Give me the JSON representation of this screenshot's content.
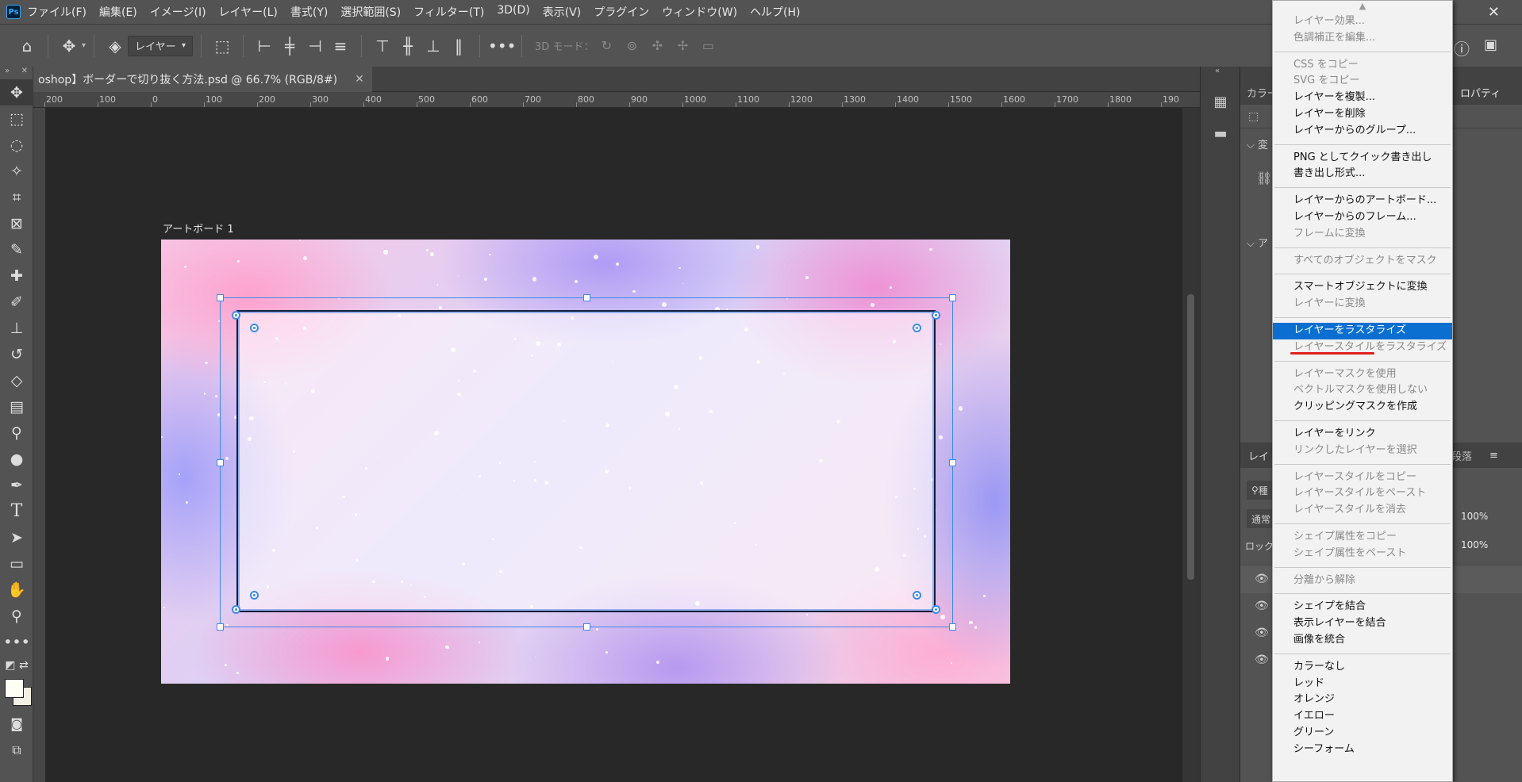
{
  "app": {
    "logo": "Ps"
  },
  "menu": [
    "ファイル(F)",
    "編集(E)",
    "イメージ(I)",
    "レイヤー(L)",
    "書式(Y)",
    "選択範囲(S)",
    "フィルター(T)",
    "3D(D)",
    "表示(V)",
    "プラグイン",
    "ウィンドウ(W)",
    "ヘルプ(H)"
  ],
  "options": {
    "layer_select": "レイヤー",
    "mode_3d": "3D モード："
  },
  "document": {
    "tab_title": "oshop】ボーダーで切り抜く方法.psd @ 66.7% (RGB/8#)",
    "artboard_label": "アートボード 1"
  },
  "ruler": [
    "200",
    "100",
    "0",
    "100",
    "200",
    "300",
    "400",
    "500",
    "600",
    "700",
    "800",
    "900",
    "1000",
    "1100",
    "1200",
    "1300",
    "1400",
    "1500",
    "1600",
    "1700",
    "1800",
    "190"
  ],
  "right_panel": {
    "tabs_top": [
      "カラー",
      "ロパティ"
    ],
    "section1": "変",
    "section2": "ア",
    "layers_tab": "レイ",
    "para_tab": "段落",
    "search": "種",
    "blend": "通常",
    "lock": "ロック",
    "opacity": "100%",
    "fill": "100%"
  },
  "context_menu": {
    "groups": [
      [
        {
          "label": "レイヤー効果...",
          "disabled": true
        },
        {
          "label": "色調補正を編集...",
          "disabled": true
        }
      ],
      [
        {
          "label": "CSS をコピー",
          "disabled": true
        },
        {
          "label": "SVG をコピー",
          "disabled": true
        },
        {
          "label": "レイヤーを複製...",
          "disabled": false
        },
        {
          "label": "レイヤーを削除",
          "disabled": false
        },
        {
          "label": "レイヤーからのグループ...",
          "disabled": false
        }
      ],
      [
        {
          "label": "PNG としてクイック書き出し",
          "disabled": false
        },
        {
          "label": "書き出し形式...",
          "disabled": false
        }
      ],
      [
        {
          "label": "レイヤーからのアートボード...",
          "disabled": false
        },
        {
          "label": "レイヤーからのフレーム...",
          "disabled": false
        },
        {
          "label": "フレームに変換",
          "disabled": true
        }
      ],
      [
        {
          "label": "すべてのオブジェクトをマスク",
          "disabled": true
        }
      ],
      [
        {
          "label": "スマートオブジェクトに変換",
          "disabled": false
        },
        {
          "label": "レイヤーに変換",
          "disabled": true
        }
      ],
      [
        {
          "label": "レイヤーをラスタライズ",
          "disabled": false,
          "highlighted": true
        },
        {
          "label": "レイヤースタイルをラスタライズ",
          "disabled": true
        }
      ],
      [
        {
          "label": "レイヤーマスクを使用",
          "disabled": true
        },
        {
          "label": "ベクトルマスクを使用しない",
          "disabled": true
        },
        {
          "label": "クリッピングマスクを作成",
          "disabled": false
        }
      ],
      [
        {
          "label": "レイヤーをリンク",
          "disabled": false
        },
        {
          "label": "リンクしたレイヤーを選択",
          "disabled": true
        }
      ],
      [
        {
          "label": "レイヤースタイルをコピー",
          "disabled": true
        },
        {
          "label": "レイヤースタイルをペースト",
          "disabled": true
        },
        {
          "label": "レイヤースタイルを消去",
          "disabled": true
        }
      ],
      [
        {
          "label": "シェイプ属性をコピー",
          "disabled": true
        },
        {
          "label": "シェイプ属性をペースト",
          "disabled": true
        }
      ],
      [
        {
          "label": "分離から解除",
          "disabled": true
        }
      ],
      [
        {
          "label": "シェイプを結合",
          "disabled": false
        },
        {
          "label": "表示レイヤーを結合",
          "disabled": false
        },
        {
          "label": "画像を統合",
          "disabled": false
        }
      ],
      [
        {
          "label": "カラーなし",
          "disabled": false
        },
        {
          "label": "レッド",
          "disabled": false
        },
        {
          "label": "オレンジ",
          "disabled": false
        },
        {
          "label": "イエロー",
          "disabled": false
        },
        {
          "label": "グリーン",
          "disabled": false
        },
        {
          "label": "シーフォーム",
          "disabled": false
        }
      ]
    ]
  },
  "colors": {
    "highlight": "#0a6fd1",
    "bbox": "#3d8ae6",
    "annotation": "#e02020"
  }
}
